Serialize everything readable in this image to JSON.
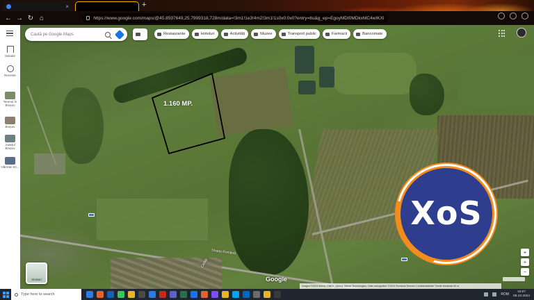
{
  "browser": {
    "tab_title": "",
    "url": "https://www.google.com/maps/@45.8597649,25.7999318,728m/data=!3m1!1e3!4m2!3m1!1s0x0:0x0?entry=ttu&g_ep=EgoyMDI0MDkxMC4wIKXMDSoASAFQAw%3D%3D",
    "nav": {
      "back_icon": "←",
      "forward_icon": "→",
      "reload_icon": "↻",
      "home_icon": "⌂"
    },
    "new_tab_icon": "+",
    "tab_close_icon": "×"
  },
  "maps": {
    "rail": {
      "menu_icon": "menu-icon",
      "saved_label": "Salvate",
      "recent_label": "Recente",
      "recent_places": [
        {
          "label": "Terenul în Brașov",
          "color": "#7a8c6a"
        },
        {
          "label": "Brașov",
          "color": "#8a7f70"
        },
        {
          "label": "Județul Brașov",
          "color": "#6f7f86"
        },
        {
          "label": "Hărman 62...",
          "color": "#5b6f8a"
        }
      ]
    },
    "search": {
      "placeholder": "Caută pe Google Maps"
    },
    "chips": [
      {
        "label": "Restaurante",
        "icon": "restaurant-icon"
      },
      {
        "label": "Hoteluri",
        "icon": "hotel-icon"
      },
      {
        "label": "Activități",
        "icon": "activities-icon"
      },
      {
        "label": "Muzee",
        "icon": "museum-icon"
      },
      {
        "label": "Transport public",
        "icon": "transit-icon"
      },
      {
        "label": "Farmacii",
        "icon": "pharmacy-icon"
      },
      {
        "label": "Bancomate",
        "icon": "atm-icon"
      }
    ],
    "parcel_label": "1.160 MP.",
    "road_label": "Strada Română",
    "road_label_2": "Cetății",
    "layers_label": "Straturi",
    "google_wordmark": "Google",
    "attribution": "Imagini ©2024 Airbus, CNES / Airbus, Maxar Technologies, Date cartografice ©2024   România   Termeni   Confidențialitate   Trimite feedback   50 m",
    "controls": {
      "zoom_in": "+",
      "zoom_out": "−",
      "pegman": "⌖"
    }
  },
  "overlay_logo": {
    "text": "XoS",
    "ring_color": "#f28c1c",
    "fill_color": "#2e3d8e"
  },
  "taskbar": {
    "search_placeholder": "Type here to search",
    "apps": [
      "#2d7be0",
      "#e0622d",
      "#1a5fb4",
      "#3ac45e",
      "#e8b52a",
      "#4a4a4a",
      "#2d7be0",
      "#c42b1c",
      "#5b5fc7",
      "#2c6e49",
      "#1a73e8",
      "#e0622d",
      "#7c4dff",
      "#e8b52a",
      "#00a4ef",
      "#0067c0",
      "#6a6a6a",
      "#e8b52a",
      "#3a3a3a"
    ],
    "clock_time": "15:07",
    "clock_date": "08.10.2024",
    "language": "ROM"
  }
}
